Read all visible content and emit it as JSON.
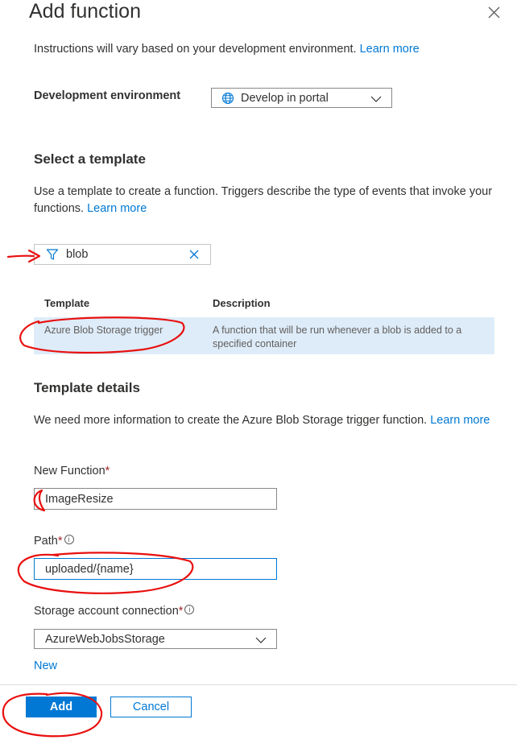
{
  "panel": {
    "title": "Add function",
    "intro_text": "Instructions will vary based on your development environment.",
    "intro_link": "Learn more"
  },
  "dev_env": {
    "label": "Development environment",
    "value": "Develop in portal"
  },
  "template_section": {
    "heading": "Select a template",
    "description": "Use a template to create a function. Triggers describe the type of events that invoke your functions.",
    "link": "Learn more",
    "filter_value": "blob",
    "columns": [
      "Template",
      "Description"
    ],
    "rows": [
      {
        "template": "Azure Blob Storage trigger",
        "description": "A function that will be run whenever a blob is added to a specified container"
      }
    ]
  },
  "details_section": {
    "heading": "Template details",
    "description": "We need more information to create the Azure Blob Storage trigger function.",
    "link": "Learn more",
    "new_function_label": "New Function",
    "new_function_value": "ImageResize",
    "path_label": "Path",
    "path_value": "uploaded/{name}",
    "storage_label": "Storage account connection",
    "storage_value": "AzureWebJobsStorage",
    "new_link": "New",
    "required_mark": "*",
    "info_glyph": "i"
  },
  "footer": {
    "add_label": "Add",
    "cancel_label": "Cancel"
  },
  "colors": {
    "accent": "#0078d4",
    "selected_row": "#deecf9",
    "annotation": "#e8100f"
  }
}
